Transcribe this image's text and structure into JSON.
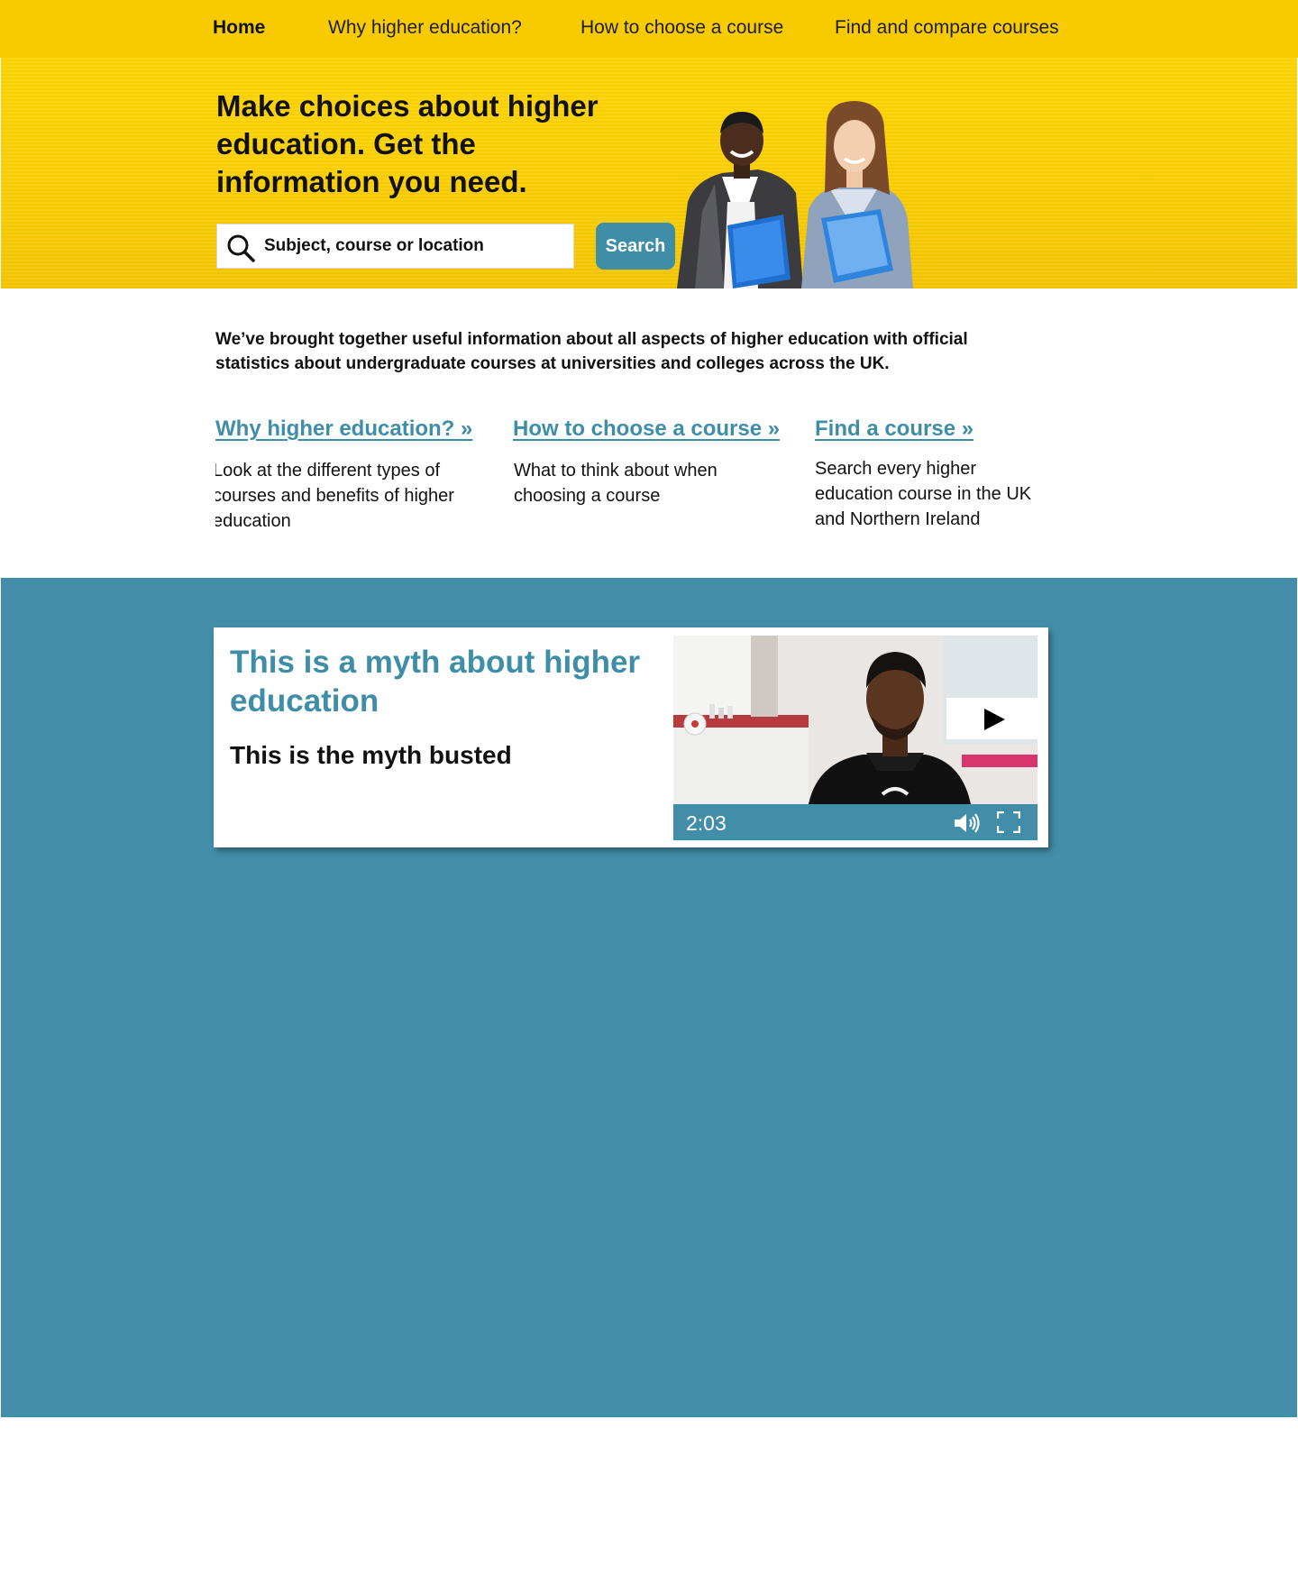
{
  "nav": {
    "items": [
      {
        "label": "Home",
        "active": true
      },
      {
        "label": "Why higher education?"
      },
      {
        "label": "How to choose a course"
      },
      {
        "label": "Find and compare courses"
      }
    ]
  },
  "hero": {
    "heading": "Make choices about higher education.  Get the information you need.",
    "search": {
      "placeholder": "Subject, course or location",
      "button_label": "Search"
    }
  },
  "intro": "We’ve brought together useful information about all aspects of higher education with official statistics about undergraduate courses at universities and colleges across the UK.",
  "features": [
    {
      "link": "Why higher education? »",
      "description": "Look at the different types of courses and benefits of higher education"
    },
    {
      "link": "How to choose a course »",
      "description": "What to think about when choosing a course"
    },
    {
      "link": "Find a course »",
      "description": "Search every higher education course in the UK and Northern Ireland"
    }
  ],
  "myth_card": {
    "title": "This is a myth about higher education",
    "subtitle": "This is the myth busted",
    "video": {
      "duration": "2:03",
      "play_icon": "play-icon",
      "volume_icon": "volume-icon",
      "fullscreen_icon": "fullscreen-icon"
    }
  },
  "colors": {
    "brand_yellow": "#f8cb00",
    "accent_teal": "#428ea8",
    "link_teal": "#3f8ea8",
    "text": "#111111"
  }
}
